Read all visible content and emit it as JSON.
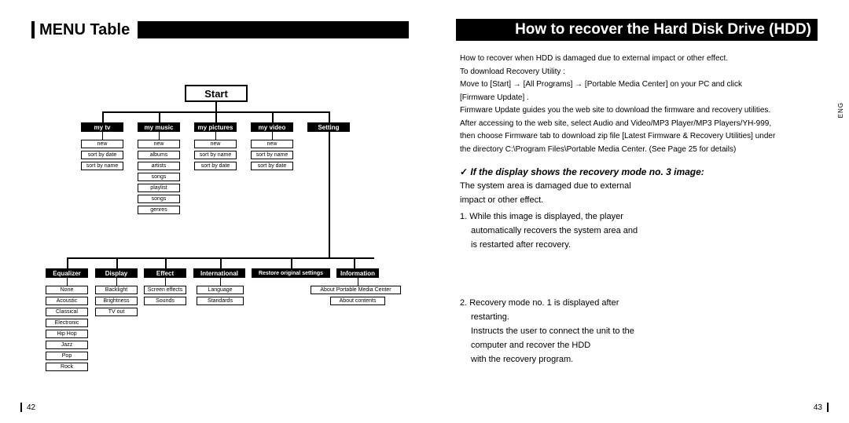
{
  "header": {
    "left_title": "MENU Table",
    "right_title": "How to recover the Hard Disk Drive (HDD)"
  },
  "eng_tab": "ENG",
  "page_numbers": {
    "left": "42",
    "right": "43"
  },
  "diagram": {
    "start": "Start",
    "row1": [
      "my tv",
      "my music",
      "my pictures",
      "my video",
      "Setting"
    ],
    "sub": {
      "my_tv": [
        "new",
        "sort by date",
        "sort by name"
      ],
      "my_music": [
        "new",
        "albums",
        "artists",
        "songs",
        "playlist",
        "songs",
        "genres"
      ],
      "my_pictures": [
        "new",
        "sort by name",
        "sort by date"
      ],
      "my_video": [
        "new",
        "sort by name",
        "sort by date"
      ]
    },
    "row2": [
      "Equalizer",
      "Display",
      "Effect",
      "International",
      "Restore original settings",
      "Information"
    ],
    "sub2": {
      "equalizer": [
        "None",
        "Acoustic",
        "Classical",
        "Electronic",
        "Hip Hop",
        "Jazz",
        "Pop",
        "Rock"
      ],
      "display": [
        "Backlight",
        "Brightness",
        "TV out"
      ],
      "effect": [
        "Screen effects",
        "Sounds"
      ],
      "international": [
        "Language",
        "Standards"
      ],
      "information": [
        "About Portable Media Center",
        "About contents"
      ]
    }
  },
  "right": {
    "intro_l1": "How to recover when HDD is damaged due to external impact or other effect.",
    "intro_l2": "To download Recovery Utility :",
    "intro_l3": "Move to [Start]  → [All Programs]  → [Portable Media Center]  on your PC and click",
    "intro_l4": "[Firmware Update] .",
    "intro_l5": "Firmware Update guides you the web site to download the firmware and recovery utilities.",
    "intro_l6": "After accessing to the web site, select Audio and Video/MP3 Player/MP3 Players/YH-999,",
    "intro_l7": "then choose Firmware tab to download zip file [Latest Firmware & Recovery Utilities]  under",
    "intro_l8": "the directory C:\\Program Files\\Portable Media Center. (See Page 25 for details)",
    "subhead": "If the display shows the recovery mode no. 3 image:",
    "p1": "The system area is damaged due to external",
    "p2": "impact or other effect.",
    "li1a": "1. While this image is displayed, the player",
    "li1b": "automatically recovers the system area and",
    "li1c": "is restarted after recovery.",
    "li2a": "2. Recovery mode no. 1 is displayed after",
    "li2b": "restarting.",
    "li2c": "Instructs the user to connect the unit to the",
    "li2d": "computer and recover the HDD",
    "li2e": "with the recovery program."
  }
}
